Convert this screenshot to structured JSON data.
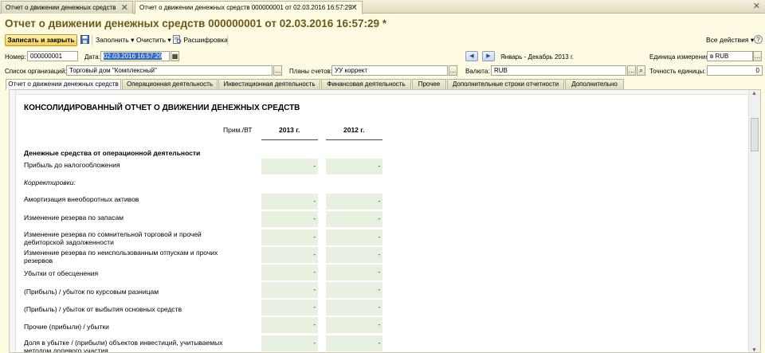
{
  "tabs": [
    {
      "label": "Отчет о движении денежных средств"
    },
    {
      "label": "Отчет о движении денежных средств 000000001 от 02.03.2016 16:57:29 *"
    }
  ],
  "window_title": "Отчет о движении денежных средств 000000001 от 02.03.2016 16:57:29 *",
  "toolbar": {
    "save_close": "Записать и закрыть",
    "fill": "Заполнить",
    "clear": "Очистить",
    "decode": "Расшифровка",
    "all_actions": "Все действия"
  },
  "fields": {
    "number_label": "Номер:",
    "number_value": "000000001",
    "date_label": "Дата:",
    "date_value": "02.03.2016 16:57:29",
    "period": "Январь - Декабрь 2013 г.",
    "unit_label": "Единица измерения:",
    "unit_value": "в RUB",
    "orgs_label": "Список организаций:",
    "orgs_value": "Торговый дом \"Комплексный\"",
    "plans_label": "Планы счетов:",
    "plans_value": "УУ коррект",
    "currency_label": "Валюта:",
    "currency_value": "RUB",
    "precision_label": "Точность единицы:",
    "precision_value": "0"
  },
  "report_tabs": [
    {
      "label": "Отчет о движении денежных средств"
    },
    {
      "label": "Операционная деятельность"
    },
    {
      "label": "Инвестиционная деятельность"
    },
    {
      "label": "Финансовая деятельность"
    },
    {
      "label": "Прочее"
    },
    {
      "label": "Дополнительные строки отчетности"
    },
    {
      "label": "Дополнительно"
    }
  ],
  "report": {
    "title": "КОНСОЛИДИРОВАННЫЙ ОТЧЕТ О ДВИЖЕНИИ ДЕНЕЖНЫХ СРЕДСТВ",
    "col_note": "Прим./ВТ",
    "col_2013": "2013 г.",
    "col_2012": "2012 г.",
    "rows": [
      {
        "label": "Денежные средства от операционной деятельности",
        "style": "b",
        "v2013": "",
        "v2012": ""
      },
      {
        "label": "Прибыль до налогообложения",
        "style": "",
        "v2013": "-",
        "v2012": "-"
      },
      {
        "label": "Корректировки:",
        "style": "i",
        "v2013": "",
        "v2012": ""
      },
      {
        "label": "Амортизация внеоборотных активов",
        "style": "",
        "v2013": "-",
        "v2012": "-"
      },
      {
        "label": "Изменение резерва по запасам",
        "style": "",
        "v2013": "-",
        "v2012": "-"
      },
      {
        "label": "Изменение резерва по сомнительной торговой и прочей дебиторской задолженности",
        "style": "",
        "v2013": "-",
        "v2012": "-"
      },
      {
        "label": "Изменение резерва по неиспользованным отпускам и прочих резервов",
        "style": "",
        "v2013": "-",
        "v2012": "-"
      },
      {
        "label": "Убытки от обесценения",
        "style": "",
        "v2013": "-",
        "v2012": "-"
      },
      {
        "label": "(Прибыль) / убыток по курсовым разницам",
        "style": "",
        "v2013": "-",
        "v2012": "-"
      },
      {
        "label": "(Прибыль) / убыток  от выбытия основных средств",
        "style": "",
        "v2013": "-",
        "v2012": "-"
      },
      {
        "label": "Прочие (прибыли) / убытки",
        "style": "",
        "v2013": "-",
        "v2012": "-"
      },
      {
        "label": "Доля в убытке / (прибыли) объектов инвестиций, учитываемых методом долевого участия",
        "style": "",
        "v2013": "-",
        "v2012": "-"
      }
    ]
  }
}
